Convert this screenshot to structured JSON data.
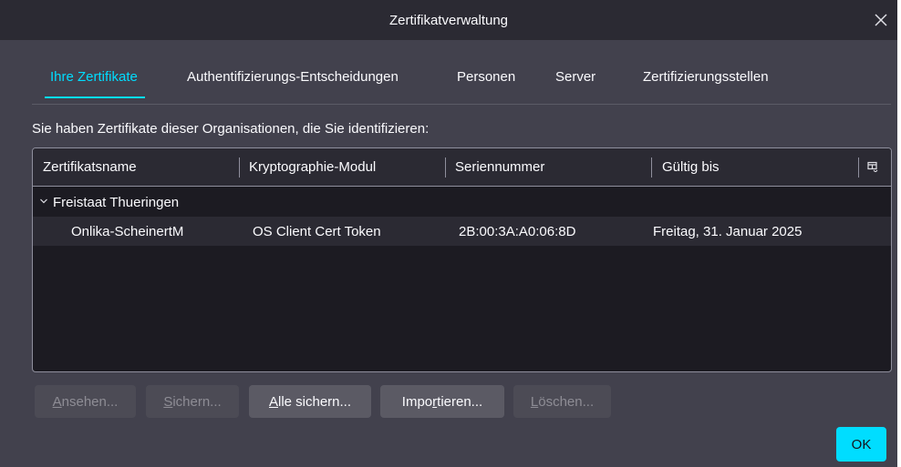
{
  "window": {
    "title": "Zertifikatverwaltung"
  },
  "tabs": [
    {
      "label": "Ihre Zertifikate",
      "active": true
    },
    {
      "label": "Authentifizierungs-Entscheidungen",
      "active": false
    },
    {
      "label": "Personen",
      "active": false
    },
    {
      "label": "Server",
      "active": false
    },
    {
      "label": "Zertifizierungsstellen",
      "active": false
    }
  ],
  "intro_text": "Sie haben Zertifikate dieser Organisationen, die Sie identifizieren:",
  "table": {
    "columns": [
      "Zertifikatsname",
      "Kryptographie-Modul",
      "Seriennummer",
      "Gültig bis"
    ],
    "groups": [
      {
        "name": "Freistaat Thueringen",
        "expanded": true,
        "rows": [
          {
            "name": "Onlika-ScheinertM",
            "module": "OS Client Cert Token",
            "serial": "2B:00:3A:A0:06:8D",
            "valid_until": "Freitag, 31. Januar 2025"
          }
        ]
      }
    ]
  },
  "buttons": {
    "view": {
      "accel": "A",
      "rest": "nsehen...",
      "enabled": false
    },
    "backup": {
      "accel": "S",
      "rest": "ichern...",
      "enabled": false
    },
    "backup_all": {
      "accel": "A",
      "rest": "lle sichern...",
      "enabled": true
    },
    "import": {
      "pre": "Impo",
      "accel": "r",
      "rest": "tieren...",
      "enabled": true
    },
    "delete": {
      "accel": "L",
      "rest": "öschen...",
      "enabled": false
    },
    "ok": "OK"
  },
  "colors": {
    "accent": "#00ddff",
    "dialog_bg": "#42414d",
    "titlebar_bg": "#2b2a33",
    "table_bg": "#1c1b22"
  }
}
